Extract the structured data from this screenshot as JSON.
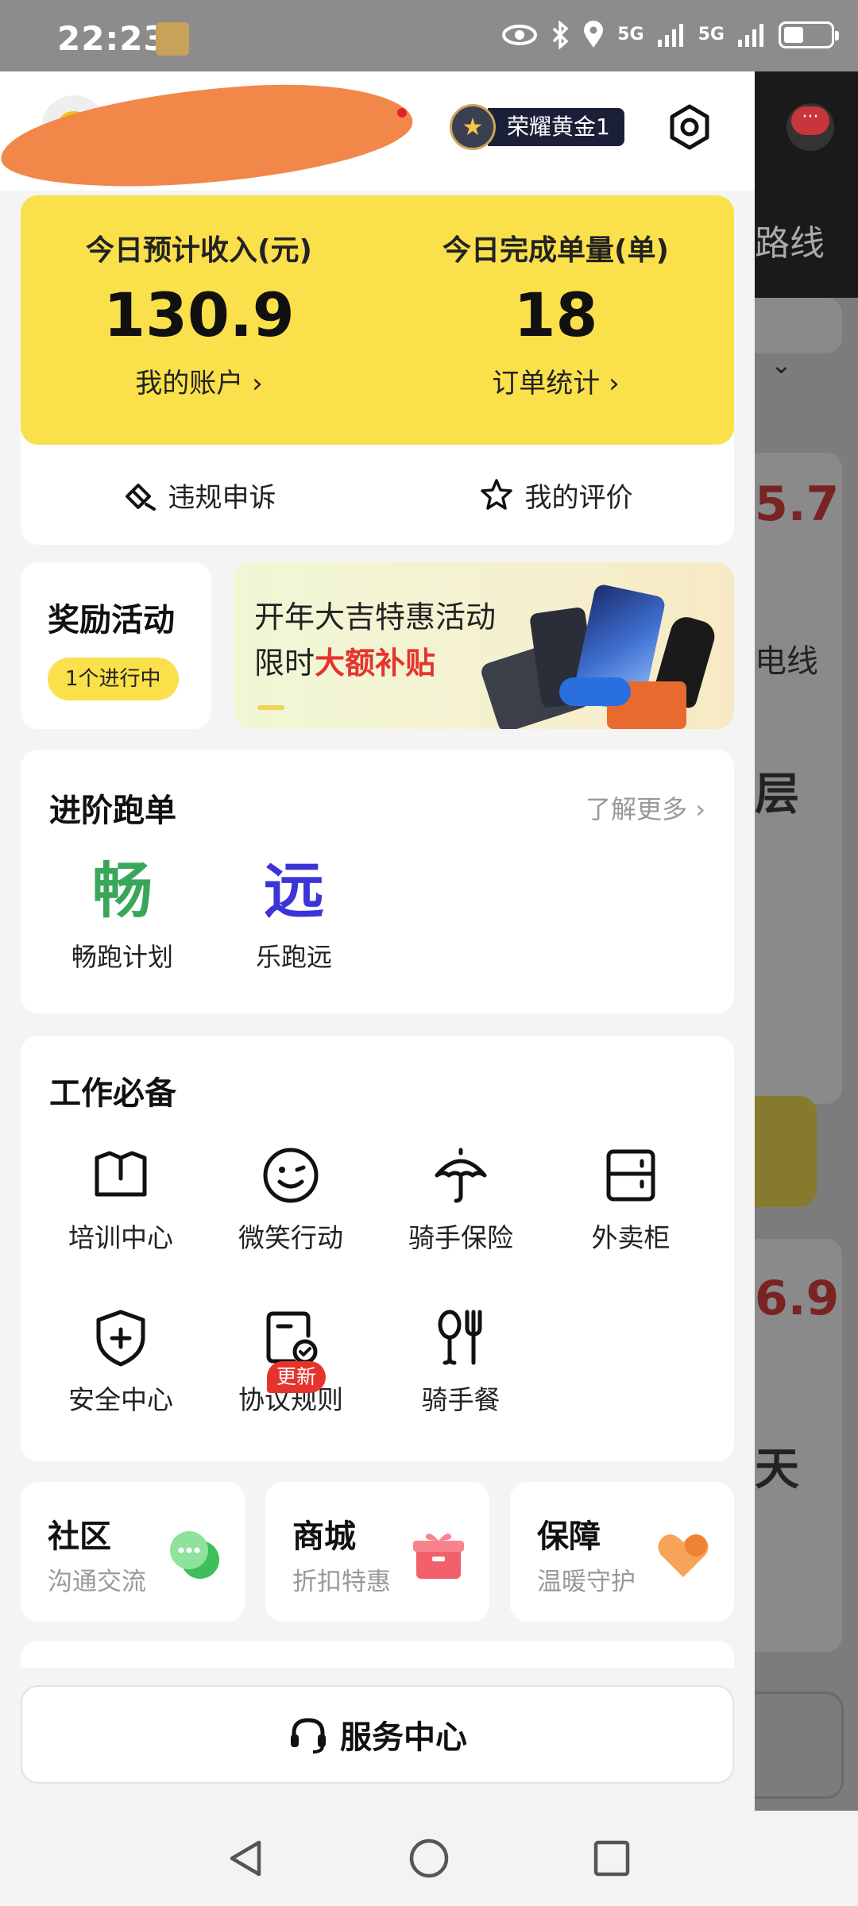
{
  "status_bar": {
    "time": "22:23",
    "network_1": "5G",
    "network_2": "5G"
  },
  "header": {
    "level_badge": "荣耀黄金1"
  },
  "income": {
    "left_label": "今日预计收入(元)",
    "left_value": "130.9",
    "left_link": "我的账户",
    "right_label": "今日完成单量(单)",
    "right_value": "18",
    "right_link": "订单统计",
    "action_1": "违规申诉",
    "action_2": "我的评价"
  },
  "reward": {
    "title": "奖励活动",
    "status": "1个进行中"
  },
  "banner": {
    "line1": "开年大吉特惠活动",
    "line2_prefix": "限时",
    "line2_highlight": "大额补贴"
  },
  "advanced": {
    "title": "进阶跑单",
    "more": "了解更多",
    "items": [
      {
        "glyph": "畅",
        "label": "畅跑计划",
        "color": "#3aa65a"
      },
      {
        "glyph": "远",
        "label": "乐跑远",
        "color": "#3b34d6"
      }
    ]
  },
  "work": {
    "title": "工作必备",
    "items": [
      {
        "label": "培训中心",
        "icon": "book-icon"
      },
      {
        "label": "微笑行动",
        "icon": "smile-icon"
      },
      {
        "label": "骑手保险",
        "icon": "umbrella-icon"
      },
      {
        "label": "外卖柜",
        "icon": "locker-icon"
      },
      {
        "label": "安全中心",
        "icon": "shield-icon"
      },
      {
        "label": "协议规则",
        "icon": "agreement-icon"
      },
      {
        "label": "骑手餐",
        "icon": "meal-icon"
      }
    ],
    "new_badge": "更新"
  },
  "shortcuts": [
    {
      "title": "社区",
      "subtitle": "沟通交流",
      "icon": "chat-icon"
    },
    {
      "title": "商城",
      "subtitle": "折扣特惠",
      "icon": "gift-icon"
    },
    {
      "title": "保障",
      "subtitle": "温暖守护",
      "icon": "heart-icon"
    }
  ],
  "service": {
    "label": "服务中心"
  },
  "background_page": {
    "route_text": "路线",
    "value_1": "5.7",
    "text_1": "电线",
    "text_2": "层",
    "value_2": "6.9",
    "text_3": "天"
  },
  "colors": {
    "accent_yellow": "#fae04b",
    "highlight_red": "#e4342c"
  }
}
